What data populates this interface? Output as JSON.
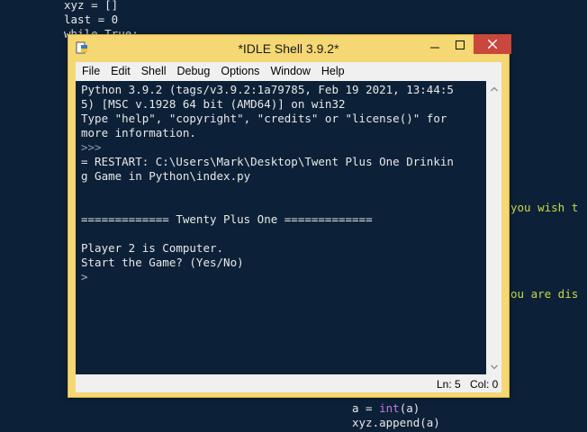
{
  "background_code": {
    "lines_top": [
      "xyz = []",
      "last = 0",
      "while True:"
    ],
    "right_fragments": [
      "you wish t",
      "ou are dis"
    ],
    "lines_bottom": [
      "a = int(a)",
      "xyz.append(a)"
    ]
  },
  "window": {
    "title": "*IDLE Shell 3.9.2*",
    "menu": [
      "File",
      "Edit",
      "Shell",
      "Debug",
      "Options",
      "Window",
      "Help"
    ]
  },
  "shell": {
    "lines": [
      "Python 3.9.2 (tags/v3.9.2:1a79785, Feb 19 2021, 13:44:5",
      "5) [MSC v.1928 64 bit (AMD64)] on win32",
      "Type \"help\", \"copyright\", \"credits\" or \"license()\" for",
      "more information.",
      ">>>",
      "= RESTART: C:\\Users\\Mark\\Desktop\\Twent Plus One Drinkin",
      "g Game in Python\\index.py",
      "",
      "",
      "============= Twenty Plus One =============",
      "",
      "Player 2 is Computer.",
      "Start the Game? (Yes/No)",
      ">"
    ]
  },
  "status": {
    "line": "Ln: 5",
    "col": "Col: 0"
  },
  "colors": {
    "editor_bg": "#0c2138",
    "window_frame": "#f5d774",
    "close_button": "#c9473c",
    "keyword_purple": "#c678dd",
    "string_green": "#c8d84a"
  }
}
